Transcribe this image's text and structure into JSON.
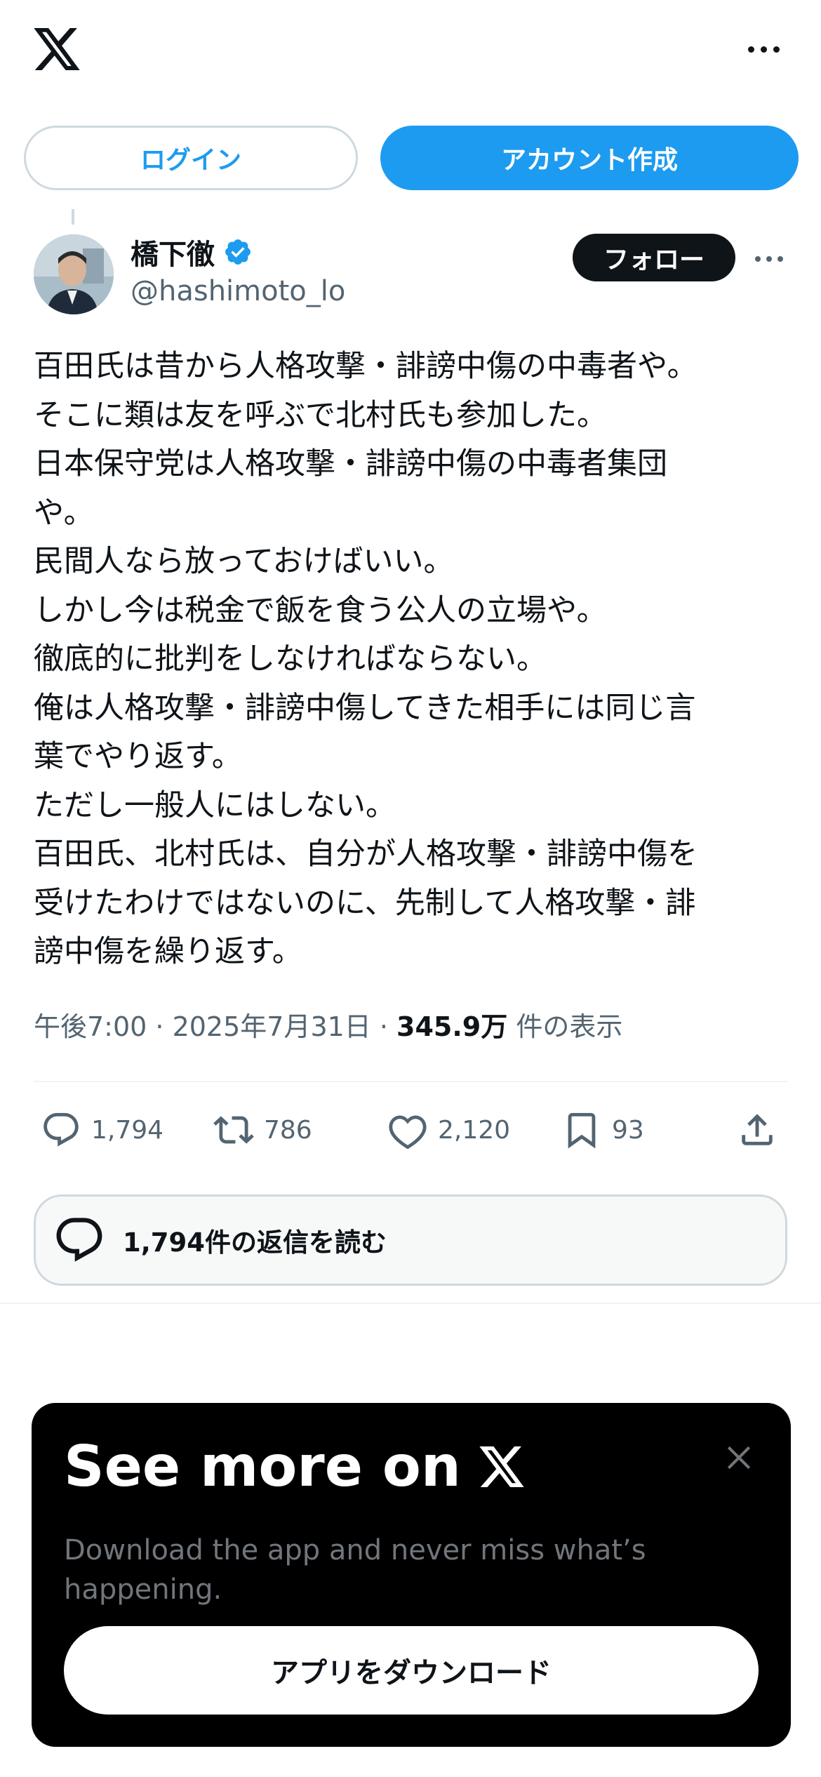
{
  "header": {
    "logo_icon": "x-logo-icon",
    "more_icon": "more-horizontal-icon"
  },
  "auth": {
    "login_label": "ログイン",
    "signup_label": "アカウント作成"
  },
  "tweet": {
    "author_name": "橋下徹",
    "verified": true,
    "handle": "@hashimoto_lo",
    "follow_label": "フォロー",
    "body": "百田氏は昔から人格攻撃・誹謗中傷の中毒者や。\nそこに類は友を呼ぶで北村氏も参加した。\n日本保守党は人格攻撃・誹謗中傷の中毒者集団\nや。\n民間人なら放っておけばいい。\nしかし今は税金で飯を食う公人の立場や。\n徹底的に批判をしなければならない。\n俺は人格攻撃・誹謗中傷してきた相手には同じ言\n葉でやり返す。\nただし一般人にはしない。\n百田氏、北村氏は、自分が人格攻撃・誹謗中傷を\n受けたわけではないのに、先制して人格攻撃・誹\n謗中傷を繰り返す。",
    "time": "午後7:00 · 2025年7月31日 · ",
    "views_count": "345.9万",
    "views_label": " 件の表示",
    "replies": "1,794",
    "retweets": "786",
    "likes": "2,120",
    "bookmarks": "93",
    "read_replies_label": "1,794件の返信を読む"
  },
  "promo": {
    "title": "See more on",
    "description": "Download the app and never miss what’s happening.",
    "download_label": "アプリをダウンロード"
  },
  "colors": {
    "accent": "#1d9bf0",
    "text": "#0f1419",
    "secondary": "#536471",
    "border": "#cfd9de"
  }
}
